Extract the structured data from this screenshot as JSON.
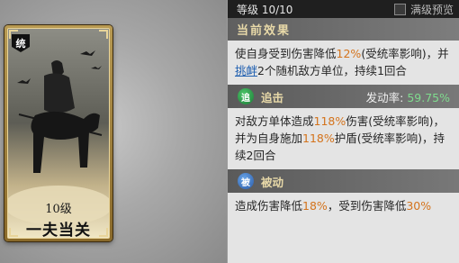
{
  "header": {
    "level_text": "等级 10/10",
    "preview_label": "满级预览"
  },
  "card": {
    "tag": "统",
    "level_text": "10级",
    "name": "一夫当关"
  },
  "current_effect": {
    "title": "当前效果",
    "text_1": "使自身受到伤害降低",
    "pct_1": "12%",
    "text_2": "(受统率影响)，并",
    "link": "挑衅",
    "text_3": "2个随机敌方单位，持续1回合"
  },
  "pursuit": {
    "badge": "追",
    "label": "追击",
    "rate_label": "发动率:",
    "rate_value": "59.75%",
    "text_1": "对敌方单体造成",
    "pct_1": "118%",
    "text_2": "伤害(受统率影响)，并为自身施加",
    "pct_2": "118%",
    "text_3": "护盾(受统率影响)，持续2回合"
  },
  "passive": {
    "badge": "被",
    "label": "被动",
    "text_1": "造成伤害降低",
    "pct_1": "18%",
    "text_2": "，受到伤害降低",
    "pct_2": "30%"
  },
  "colors": {
    "highlight": "#d4731c",
    "link": "#1f5fb0",
    "rate": "#7fdc8e",
    "title_gold": "#e8d9a8"
  }
}
